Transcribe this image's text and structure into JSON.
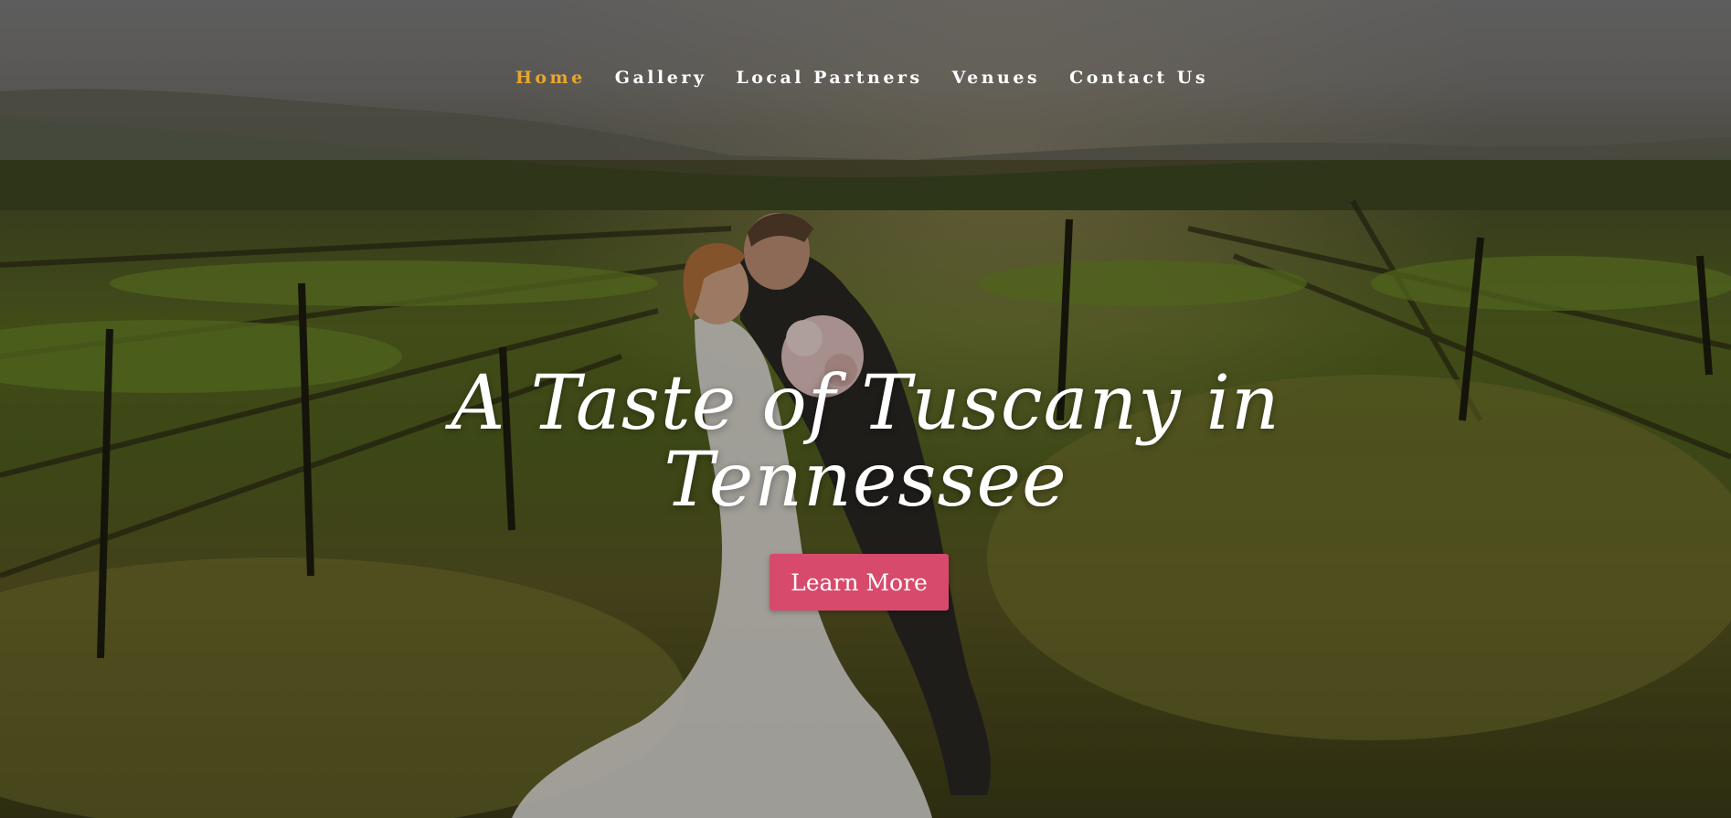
{
  "nav": {
    "items": [
      {
        "label": "Home",
        "active": true
      },
      {
        "label": "Gallery",
        "active": false
      },
      {
        "label": "Local Partners",
        "active": false
      },
      {
        "label": "Venues",
        "active": false
      },
      {
        "label": "Contact Us",
        "active": false
      }
    ]
  },
  "hero": {
    "headline_line1": "A Taste of Tuscany in",
    "headline_line2": "Tennessee",
    "cta_label": "Learn More",
    "image": "wedding-couple-vineyard-photo"
  },
  "colors": {
    "accent_active_nav": "#e8a72c",
    "cta_background": "#d84a6c",
    "text": "#ffffff"
  }
}
